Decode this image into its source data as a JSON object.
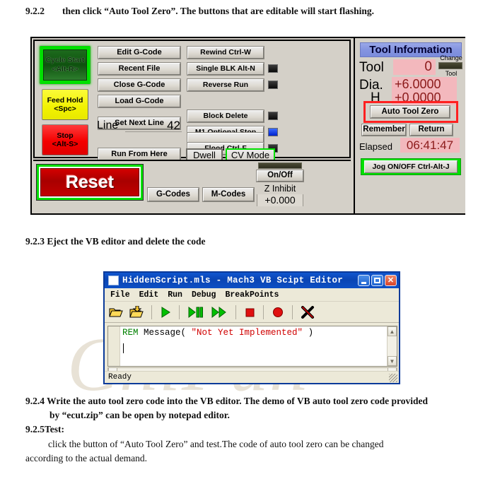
{
  "document": {
    "step_922_num": "9.2.2",
    "step_922_text": "then click “Auto Tool Zero”. The buttons that are editable will start flashing.",
    "step_923": "9.2.3 Eject the VB editor and delete the code",
    "step_924_line1": "9.2.4 Write the auto tool zero code into the VB editor. The demo of VB auto tool zero code provided",
    "step_924_line2": "by “ecut.zip” can be open by notepad editor.",
    "step_925_title": "9.2.5Test:",
    "step_925_line1": "click the button of “Auto Tool Zero” and test.The code of auto tool zero can be changed",
    "step_925_line2": "according to the actual demand.",
    "watermark": "ChiFun"
  },
  "mach3": {
    "status_buttons": {
      "cycle_start": "Cycle Start",
      "cycle_start_key": "<Alt-R>",
      "feed_hold": "Feed Hold",
      "feed_hold_key": "<Spc>",
      "stop": "Stop",
      "stop_key": "<Alt-S>"
    },
    "file_buttons": [
      "Edit G-Code",
      "Recent File",
      "Close G-Code",
      "Load G-Code"
    ],
    "set_next_line": "Set Next Line",
    "line_label": "Line",
    "line_value": "42",
    "run_from_here": "Run From Here",
    "run_buttons": [
      {
        "label": "Rewind Ctrl-W",
        "led": "none"
      },
      {
        "label": "Single BLK Alt-N",
        "led": "black"
      },
      {
        "label": "Reverse Run",
        "led": "black"
      }
    ],
    "mode_buttons": [
      {
        "label": "Block Delete",
        "led": "black"
      },
      {
        "label": "M1 Optional Stop",
        "led": "blue"
      },
      {
        "label": "Flood Ctrl-F",
        "led": "black"
      }
    ],
    "dwell": "Dwell",
    "cv_mode": "CV Mode",
    "reset": "Reset",
    "g_codes": "G-Codes",
    "m_codes": "M-Codes",
    "on_off": "On/Off",
    "z_inhibit_label": "Z Inhibit",
    "z_inhibit_value": "+0.000",
    "tool_info": {
      "header": "Tool Information",
      "tool_label": "Tool",
      "tool_value": "0",
      "change_label": "Change",
      "change_label2": "Tool",
      "dia_label": "Dia.",
      "dia_value": "+6.0000",
      "h_label": "H",
      "h_value": "+0.0000",
      "auto_tool_zero": "Auto Tool Zero",
      "remember": "Remember",
      "return": "Return",
      "elapsed_label": "Elapsed",
      "elapsed_value": "06:41:47",
      "jog": "Jog ON/OFF Ctrl-Alt-J"
    },
    "colors": {
      "panel_bg": "#d4d0c8",
      "highlight_green": "#00e000",
      "highlight_red": "#ff2020",
      "led_blue": "#0022cc",
      "value_field": "#f3b8bd",
      "value_text": "#8b1a1a",
      "title_blue": "#8494e0"
    }
  },
  "vb_editor": {
    "title": "HiddenScript.mls - Mach3 VB Scipt Editor",
    "menus": [
      "File",
      "Edit",
      "Run",
      "Debug",
      "BreakPoints"
    ],
    "toolbar_icons": [
      "open-folder-icon",
      "save-folder-icon",
      "run-icon",
      "run-pause-icon",
      "run-fast-icon",
      "stop-icon",
      "record-icon",
      "delete-icon"
    ],
    "code": {
      "keyword": "REM",
      "call": " Message( ",
      "string": "\"Not Yet Implemented\"",
      "tail": " )"
    },
    "status": "Ready",
    "scroll_up": "▲",
    "scroll_down": "▼",
    "scroll_left": "◀",
    "scroll_right": "▶"
  }
}
